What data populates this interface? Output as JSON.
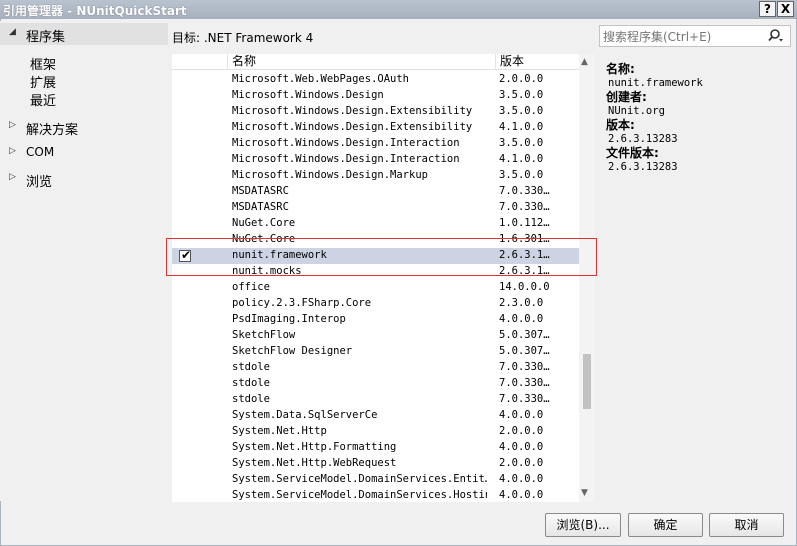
{
  "window": {
    "title": "引用管理器 - NUnitQuickStart",
    "help_label": "?",
    "close_label": "X"
  },
  "nav": {
    "assemblies": {
      "label": "程序集",
      "children": [
        "框架",
        "扩展",
        "最近"
      ]
    },
    "solution": {
      "label": "解决方案"
    },
    "com": {
      "label": "COM"
    },
    "browse": {
      "label": "浏览"
    }
  },
  "target": {
    "text": "目标: .NET Framework 4"
  },
  "search": {
    "placeholder": "搜索程序集(Ctrl+E)"
  },
  "list": {
    "columns": {
      "name": "名称",
      "version": "版本"
    },
    "rows": [
      {
        "name": "Microsoft.Web.WebPages.OAuth",
        "version": "2.0.0.0"
      },
      {
        "name": "Microsoft.Windows.Design",
        "version": "3.5.0.0"
      },
      {
        "name": "Microsoft.Windows.Design.Extensibility",
        "version": "3.5.0.0"
      },
      {
        "name": "Microsoft.Windows.Design.Extensibility",
        "version": "4.1.0.0"
      },
      {
        "name": "Microsoft.Windows.Design.Interaction",
        "version": "3.5.0.0"
      },
      {
        "name": "Microsoft.Windows.Design.Interaction",
        "version": "4.1.0.0"
      },
      {
        "name": "Microsoft.Windows.Design.Markup",
        "version": "3.5.0.0"
      },
      {
        "name": "MSDATASRC",
        "version": "7.0.330…"
      },
      {
        "name": "MSDATASRC",
        "version": "7.0.330…"
      },
      {
        "name": "NuGet.Core",
        "version": "1.0.112…"
      },
      {
        "name": "NuGet.Core",
        "version": "1.6.301…"
      },
      {
        "name": "nunit.framework",
        "version": "2.6.3.1…",
        "checked": true,
        "selected": true
      },
      {
        "name": "nunit.mocks",
        "version": "2.6.3.1…"
      },
      {
        "name": "office",
        "version": "14.0.0.0"
      },
      {
        "name": "policy.2.3.FSharp.Core",
        "version": "2.3.0.0"
      },
      {
        "name": "PsdImaging.Interop",
        "version": "4.0.0.0"
      },
      {
        "name": "SketchFlow",
        "version": "5.0.307…"
      },
      {
        "name": "SketchFlow Designer",
        "version": "5.0.307…"
      },
      {
        "name": "stdole",
        "version": "7.0.330…"
      },
      {
        "name": "stdole",
        "version": "7.0.330…"
      },
      {
        "name": "stdole",
        "version": "7.0.330…"
      },
      {
        "name": "System.Data.SqlServerCe",
        "version": "4.0.0.0"
      },
      {
        "name": "System.Net.Http",
        "version": "2.0.0.0"
      },
      {
        "name": "System.Net.Http.Formatting",
        "version": "4.0.0.0"
      },
      {
        "name": "System.Net.Http.WebRequest",
        "version": "2.0.0.0"
      },
      {
        "name": "System.ServiceModel.DomainServices.Entit…",
        "version": "4.0.0.0"
      },
      {
        "name": "System.ServiceModel.DomainServices.Hosting",
        "version": "4.0.0.0"
      }
    ],
    "check_mark": "✔"
  },
  "details": {
    "name_label": "名称:",
    "name_value": "nunit.framework",
    "creator_label": "创建者:",
    "creator_value": "NUnit.org",
    "version_label": "版本:",
    "version_value": "2.6.3.13283",
    "file_version_label": "文件版本:",
    "file_version_value": "2.6.3.13283"
  },
  "buttons": {
    "browse": "浏览(B)...",
    "ok": "确定",
    "cancel": "取消"
  },
  "icons": {
    "expanded_arrow": "◢",
    "collapsed_arrow": "▷",
    "scroll_up": "▲",
    "scroll_down": "▼"
  }
}
